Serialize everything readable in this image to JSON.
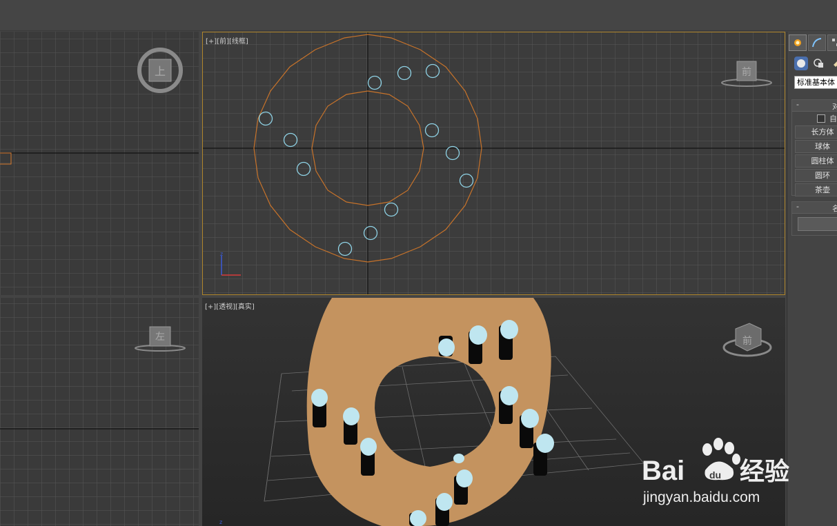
{
  "viewports": {
    "front": {
      "label_plus": "[+]",
      "label_view": "[前]",
      "label_mode": "[线框]",
      "cube_label": "前"
    },
    "top": {
      "cube_label": "上"
    },
    "left": {
      "cube_label": "左"
    },
    "perspective": {
      "label_plus": "[+]",
      "label_view": "[透视]",
      "label_mode": "[真实]",
      "cube_label": "前"
    }
  },
  "command_panel": {
    "dropdown_value": "标准基本体",
    "object_type_rollout": {
      "collapse": "-",
      "title": "对",
      "autogrid_label": "自",
      "buttons": [
        "长方体",
        "球体",
        "圆柱体",
        "圆环",
        "茶壶"
      ]
    },
    "name_rollout": {
      "collapse": "-",
      "title": "名"
    }
  },
  "watermark": {
    "brand": "Bai",
    "brand_tail": "du",
    "product": "经验",
    "url": "jingyan.baidu.com"
  },
  "colors": {
    "active_border": "#b0862b",
    "torus_wire": "#c8732a",
    "cylinder_wire": "#8fd3e6",
    "torus_fill": "#c4935f"
  }
}
